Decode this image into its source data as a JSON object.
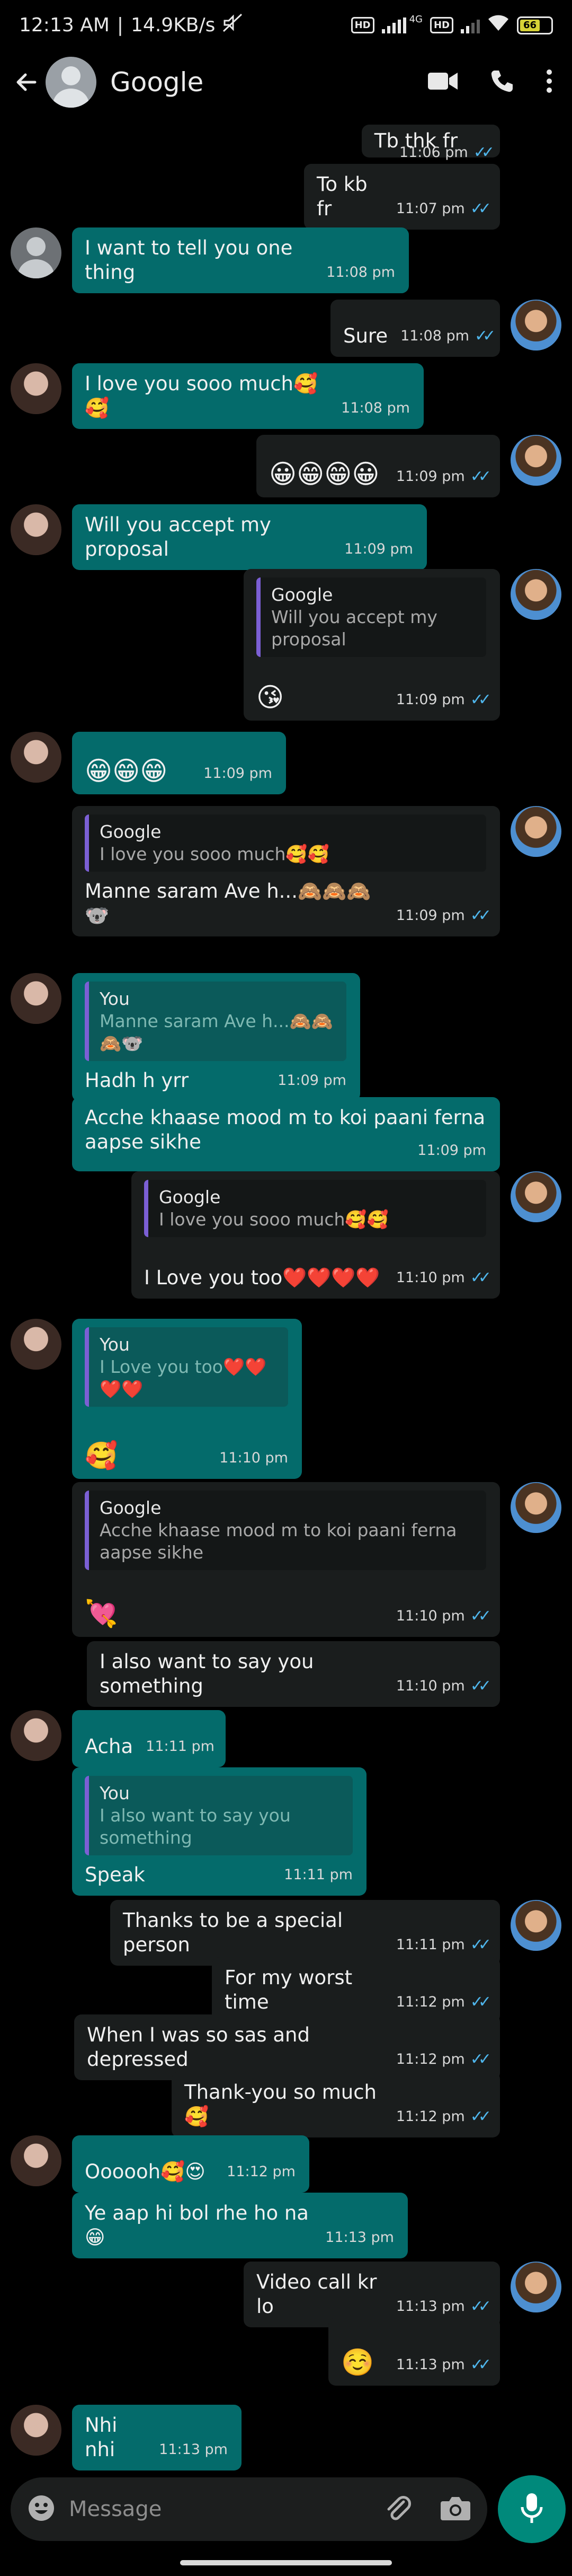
{
  "status": {
    "time": "12:13 AM",
    "speed": "14.9KB/s",
    "network": "4G",
    "battery": "66"
  },
  "header": {
    "contact_name": "Google"
  },
  "messages": [
    {
      "dir": "out",
      "text": "Tb thk fr",
      "time": "11:06 pm"
    },
    {
      "dir": "out",
      "text": "To kb fr",
      "time": "11:07 pm"
    },
    {
      "dir": "in",
      "text": "I want to tell you one thing",
      "time": "11:08 pm"
    },
    {
      "dir": "out",
      "text": "Sure",
      "time": "11:08 pm"
    },
    {
      "dir": "in",
      "text": "I love you sooo much🥰🥰",
      "time": "11:08 pm"
    },
    {
      "dir": "out",
      "text": "😀😁😁😀",
      "time": "11:09 pm"
    },
    {
      "dir": "in",
      "text": "Will you accept my proposal",
      "time": "11:09 pm"
    },
    {
      "dir": "out",
      "quote_name": "Google",
      "quote_text": "Will you accept my proposal",
      "text": "😘",
      "time": "11:09 pm"
    },
    {
      "dir": "in",
      "text": "😁😁😁",
      "time": "11:09 pm"
    },
    {
      "dir": "out",
      "quote_name": "Google",
      "quote_text": "I love you sooo much🥰🥰",
      "text": "Manne saram Ave h...🙈🙈🙈🐨",
      "time": "11:09 pm"
    },
    {
      "dir": "in",
      "quote_name": "You",
      "quote_text": "Manne saram Ave h...🙈🙈🙈🐨",
      "text": "Hadh h yrr",
      "time": "11:09 pm"
    },
    {
      "dir": "in",
      "text": "Acche khaase mood m to koi paani ferna aapse sikhe",
      "time": "11:09 pm"
    },
    {
      "dir": "out",
      "quote_name": "Google",
      "quote_text": "I love you sooo much🥰🥰",
      "text": "I Love you too❤️❤️❤️❤️",
      "time": "11:10 pm"
    },
    {
      "dir": "in",
      "quote_name": "You",
      "quote_text": "I Love you too❤️❤️❤️❤️",
      "text": "🥰",
      "time": "11:10 pm"
    },
    {
      "dir": "out",
      "quote_name": "Google",
      "quote_text": "Acche khaase mood m to koi paani ferna aapse sikhe",
      "text": "💘",
      "time": "11:10 pm"
    },
    {
      "dir": "out",
      "text": "I also want to say you something",
      "time": "11:10 pm"
    },
    {
      "dir": "in",
      "text": "Acha",
      "time": "11:11 pm"
    },
    {
      "dir": "in",
      "quote_name": "You",
      "quote_text": "I also want to say you something",
      "text": "Speak",
      "time": "11:11 pm"
    },
    {
      "dir": "out",
      "text": "Thanks to be a special person",
      "time": "11:11 pm"
    },
    {
      "dir": "out",
      "text": "For my worst time",
      "time": "11:12 pm"
    },
    {
      "dir": "out",
      "text": "When I was so sas and depressed",
      "time": "11:12 pm"
    },
    {
      "dir": "out",
      "text": "Thank-you so much🥰",
      "time": "11:12 pm"
    },
    {
      "dir": "in",
      "text": "Oooooh🥰😍",
      "time": "11:12 pm"
    },
    {
      "dir": "in",
      "text": "Ye aap hi bol rhe ho na😁",
      "time": "11:13 pm"
    },
    {
      "dir": "out",
      "text": "Video call kr lo",
      "time": "11:13 pm"
    },
    {
      "dir": "out",
      "text": "☺️",
      "time": "11:13 pm"
    },
    {
      "dir": "in",
      "text": "Nhi nhi",
      "time": "11:13 pm"
    }
  ],
  "composer": {
    "placeholder": "Message"
  },
  "icons": [
    "back-arrow-icon",
    "video-call-icon",
    "phone-icon",
    "more-icon",
    "emoji-icon",
    "attach-icon",
    "camera-icon",
    "mic-icon"
  ]
}
